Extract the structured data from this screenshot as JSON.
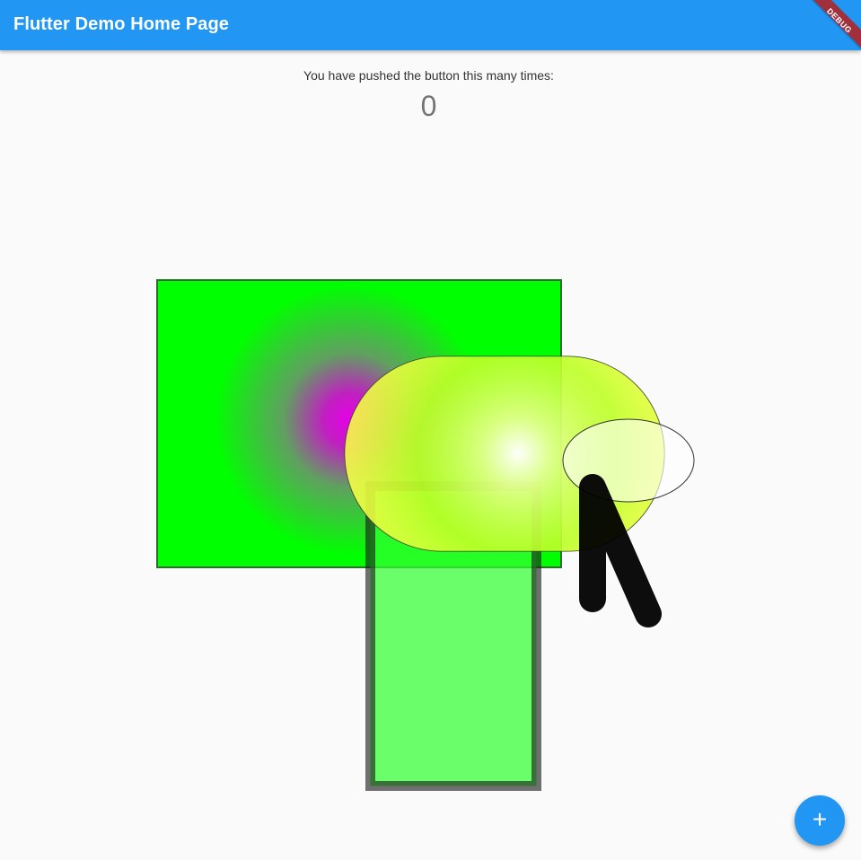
{
  "appbar": {
    "title": "Flutter Demo Home Page",
    "color": "#2196f3"
  },
  "debug_banner": {
    "label": "DEBUG",
    "color": "#a0303c"
  },
  "counter": {
    "label": "You have pushed the button this many times:",
    "value": "0"
  },
  "canvas": {
    "shapes": [
      "green-rectangle-radial-gradient",
      "yellow-stadium-radial-gradient",
      "translucent-green-rectangle",
      "outlined-ellipse",
      "black-thick-polyline"
    ],
    "colors": {
      "green": "#00ff00",
      "magenta": "#e000e0",
      "yellow": "#ffff66",
      "light_green": "#6cff6c",
      "stroke": "#000000"
    }
  },
  "fab": {
    "icon": "plus-icon",
    "glyph": "+"
  }
}
